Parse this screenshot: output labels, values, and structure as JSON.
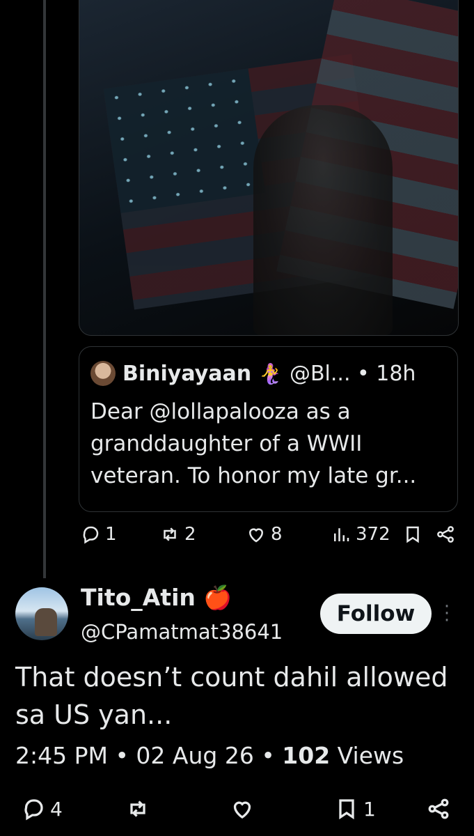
{
  "quote": {
    "name": "Biniyayaan",
    "emoji": "🧜‍♀️",
    "handle_time": "@Bl... • 18h",
    "text": "Dear @lollapalooza as a granddaughter of a WWII veteran. To honor my late gr..."
  },
  "quote_actions": {
    "replies": "1",
    "reposts": "2",
    "likes": "8",
    "views": "372"
  },
  "reply": {
    "name": "Tito_Atin",
    "emoji": "🍎",
    "handle": "@CPamatmat38641",
    "follow_label": "Follow",
    "text": "That doesn’t count dahil allowed sa US yan...",
    "time": "2:45 PM",
    "date": "02 Aug 26",
    "views_count": "102",
    "views_label": "Views"
  },
  "bottom_actions": {
    "replies": "4",
    "bookmarks": "1"
  }
}
